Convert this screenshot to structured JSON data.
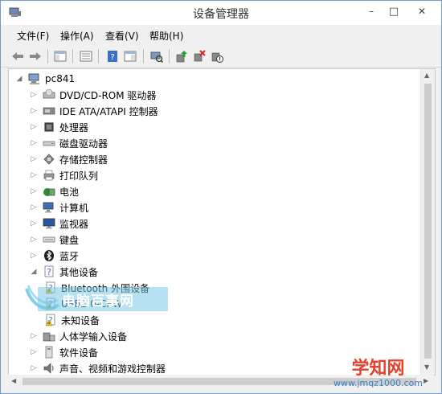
{
  "window": {
    "title": "设备管理器",
    "minimize_glyph": "–",
    "maximize_glyph": "□",
    "close_glyph": "✕"
  },
  "menu": [
    {
      "label": "文件(F)"
    },
    {
      "label": "操作(A)"
    },
    {
      "label": "查看(V)"
    },
    {
      "label": "帮助(H)"
    }
  ],
  "toolbar": {
    "icons": [
      "back-icon",
      "forward-icon",
      "console-tree-icon",
      "properties-icon",
      "help-icon",
      "action-pane-icon",
      "scan-hardware-icon",
      "update-driver-icon",
      "uninstall-device-icon",
      "disable-device-icon"
    ]
  },
  "tree": {
    "root": "pc841",
    "nodes": [
      {
        "label": "DVD/CD-ROM 驱动器",
        "icon": "dvd-drive-icon",
        "expanded": false
      },
      {
        "label": "IDE ATA/ATAPI 控制器",
        "icon": "ide-controller-icon",
        "expanded": false
      },
      {
        "label": "处理器",
        "icon": "processor-icon",
        "expanded": false
      },
      {
        "label": "磁盘驱动器",
        "icon": "disk-drive-icon",
        "expanded": false
      },
      {
        "label": "存储控制器",
        "icon": "storage-controller-icon",
        "expanded": false
      },
      {
        "label": "打印队列",
        "icon": "printer-icon",
        "expanded": false
      },
      {
        "label": "电池",
        "icon": "battery-icon",
        "expanded": false
      },
      {
        "label": "计算机",
        "icon": "computer-icon",
        "expanded": false
      },
      {
        "label": "监视器",
        "icon": "monitor-icon",
        "expanded": false
      },
      {
        "label": "键盘",
        "icon": "keyboard-icon",
        "expanded": false
      },
      {
        "label": "蓝牙",
        "icon": "bluetooth-icon",
        "expanded": false
      },
      {
        "label": "其他设备",
        "icon": "other-devices-icon",
        "expanded": true
      },
      {
        "label": "Bluetooth 外围设备",
        "icon": "unknown-device-warning-icon",
        "child": true
      },
      {
        "label": "USB2.0-CRW",
        "icon": "unknown-device-warning-icon",
        "child": true
      },
      {
        "label": "未知设备",
        "icon": "unknown-device-warning-icon",
        "child": true
      },
      {
        "label": "人体学输入设备",
        "icon": "hid-icon",
        "expanded": false
      },
      {
        "label": "软件设备",
        "icon": "software-device-icon",
        "expanded": false
      },
      {
        "label": "声音、视频和游戏控制器",
        "icon": "sound-icon",
        "expanded": false
      }
    ]
  },
  "watermarks": {
    "left": "电脑百事网",
    "right_main": "学知网",
    "right_sub": "www.jmqz1000.com"
  },
  "colors": {
    "accent": "#6e9bd1",
    "warning": "#f2c200",
    "tree_bg": "#ffffff"
  }
}
